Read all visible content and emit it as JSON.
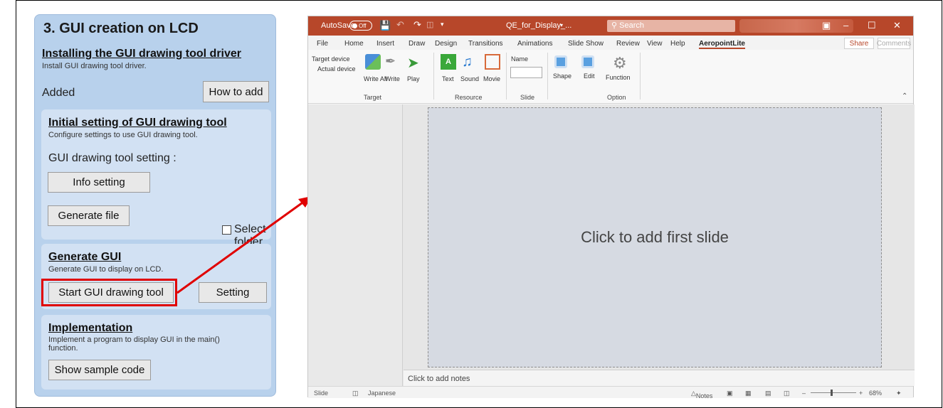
{
  "left_panel": {
    "title": "3. GUI creation on LCD",
    "installing": {
      "heading": "Installing the GUI drawing tool driver",
      "desc": "Install GUI drawing tool driver.",
      "status": "Added",
      "how_to_add_label": "How to add"
    },
    "initial": {
      "heading": "Initial setting of GUI drawing tool",
      "desc": "Configure settings to use GUI drawing tool.",
      "setting_label": "GUI drawing tool setting :",
      "info_setting_label": "Info setting",
      "generate_file_label": "Generate file",
      "select_folder_label": "Select folder"
    },
    "generate": {
      "heading": "Generate GUI",
      "desc": "Generate GUI to display on LCD.",
      "start_label": "Start GUI drawing tool",
      "setting_label": "Setting"
    },
    "implementation": {
      "heading": "Implementation",
      "desc_line1": "Implement a program to display GUI in the main()",
      "desc_line2": "function.",
      "show_sample_label": "Show sample code"
    }
  },
  "ppt": {
    "titlebar": {
      "autosave": "AutoSave",
      "toggle": "Off",
      "doc_name": "QE_for_Display_...",
      "search": "Search"
    },
    "tabs": [
      "File",
      "Home",
      "Insert",
      "Draw",
      "Design",
      "Transitions",
      "Animations",
      "Slide Show",
      "Review",
      "View",
      "Help",
      "AeropointLite"
    ],
    "share": "Share",
    "comments": "Comments",
    "ribbon": {
      "target_device": "Target device",
      "actual_device": "Actual device",
      "write_all": "Write All",
      "write": "Write",
      "play": "Play",
      "text": "Text",
      "sound": "Sound",
      "movie": "Movie",
      "name": "Name",
      "shape": "Shape",
      "edit": "Edit",
      "function": "Function",
      "groups": [
        "Target",
        "Resource",
        "Slide",
        "Option"
      ]
    },
    "slide_placeholder": "Click to add first slide",
    "notes_placeholder": "Click to add notes",
    "status": {
      "slide": "Slide",
      "language": "Japanese",
      "notes": "Notes",
      "zoom": "68%"
    }
  },
  "colors": {
    "panel_bg": "#b8d1ec",
    "card_bg": "#d2e1f3",
    "highlight": "#e00000",
    "ppt_accent": "#b7472a"
  }
}
